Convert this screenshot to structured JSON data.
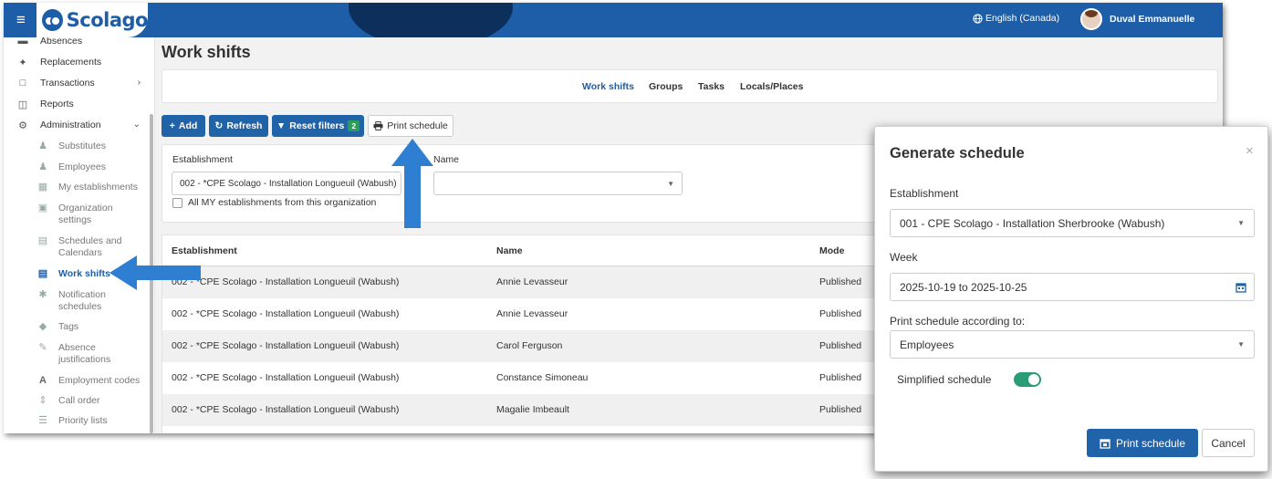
{
  "header": {
    "app_name": "Scolago",
    "language": "English (Canada)",
    "user_name": "Duval Emmanuelle"
  },
  "sidebar": {
    "items": [
      {
        "label": "Absences",
        "icon": "absences-icon"
      },
      {
        "label": "Replacements",
        "icon": "replacements-icon"
      },
      {
        "label": "Transactions",
        "icon": "transactions-icon",
        "chevron": ">"
      },
      {
        "label": "Reports",
        "icon": "reports-icon"
      },
      {
        "label": "Administration",
        "icon": "gear-icon",
        "chevron": "v"
      }
    ],
    "sub_items": [
      {
        "label": "Substitutes"
      },
      {
        "label": "Employees"
      },
      {
        "label": "My establishments"
      },
      {
        "label": "Organization settings"
      },
      {
        "label": "Schedules and Calendars"
      },
      {
        "label": "Work shifts",
        "active": true
      },
      {
        "label": "Notification schedules"
      },
      {
        "label": "Tags"
      },
      {
        "label": "Absence justifications"
      },
      {
        "label": "Employment codes"
      },
      {
        "label": "Call order"
      },
      {
        "label": "Priority lists"
      }
    ]
  },
  "page": {
    "title": "Work shifts",
    "tabs": [
      {
        "label": "Work shifts",
        "active": true
      },
      {
        "label": "Groups"
      },
      {
        "label": "Tasks"
      },
      {
        "label": "Locals/Places"
      }
    ]
  },
  "toolbar": {
    "add": "Add",
    "refresh": "Refresh",
    "reset_filters": "Reset filters",
    "reset_filters_count": "2",
    "print_schedule": "Print schedule"
  },
  "filters": {
    "establishment_label": "Establishment",
    "establishment_value": "002 - *CPE Scolago - Installation Longueuil (Wabush)",
    "all_my_establishments": "All MY establishments from this organization",
    "name_label": "Name",
    "name_value": ""
  },
  "table": {
    "columns": [
      "Establishment",
      "Name",
      "Mode"
    ],
    "rows": [
      [
        "002 - *CPE Scolago - Installation Longueuil (Wabush)",
        "Annie Levasseur",
        "Published"
      ],
      [
        "002 - *CPE Scolago - Installation Longueuil (Wabush)",
        "Annie Levasseur",
        "Published"
      ],
      [
        "002 - *CPE Scolago - Installation Longueuil (Wabush)",
        "Carol Ferguson",
        "Published"
      ],
      [
        "002 - *CPE Scolago - Installation Longueuil (Wabush)",
        "Constance Simoneau",
        "Published"
      ],
      [
        "002 - *CPE Scolago - Installation Longueuil (Wabush)",
        "Magalie Imbeault",
        "Published"
      ]
    ]
  },
  "modal": {
    "title": "Generate schedule",
    "establishment_label": "Establishment",
    "establishment_value": "001 - CPE Scolago - Installation Sherbrooke (Wabush)",
    "week_label": "Week",
    "week_value": "2025-10-19 to 2025-10-25",
    "according_label": "Print schedule according to:",
    "according_value": "Employees",
    "simplified_label": "Simplified schedule",
    "simplified_on": true,
    "print_button": "Print schedule",
    "cancel_button": "Cancel"
  },
  "colors": {
    "brand_blue": "#1e5ea8",
    "button_blue": "#2063a8",
    "toggle_green": "#2a9d74",
    "badge_green": "#2a9d5a",
    "annotation_arrow": "#2e7fd1"
  }
}
